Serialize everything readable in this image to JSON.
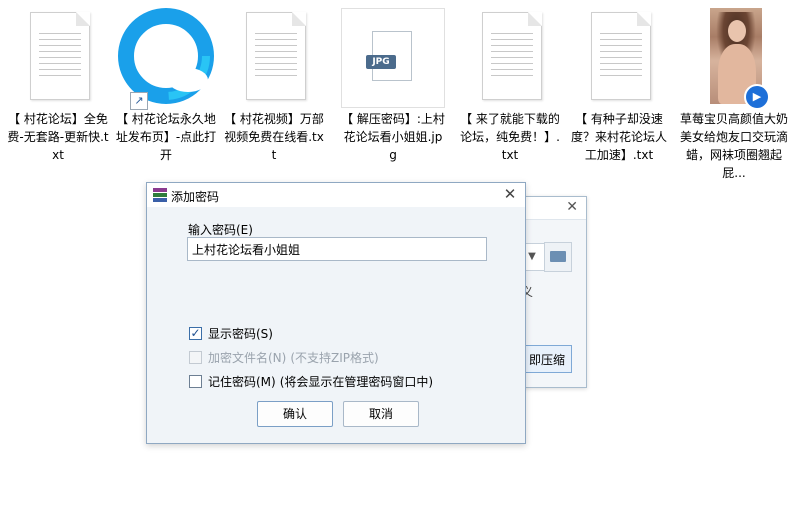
{
  "desktop": {
    "files": [
      {
        "label": "【 村花论坛】全免费-无套路-更新快.txt",
        "icon": "txt-file-icon"
      },
      {
        "label": "【 村花论坛永久地址发布页】-点此打开",
        "icon": "qq-browser-shortcut-icon"
      },
      {
        "label": "【 村花视频】万部视频免费在线看.txt",
        "icon": "txt-file-icon"
      },
      {
        "label": "【 解压密码】:上村花论坛看小姐姐.jpg",
        "icon": "jpg-file-icon",
        "badge": "JPG"
      },
      {
        "label": "【 来了就能下载的论坛，纯免费！】.txt",
        "icon": "txt-file-icon"
      },
      {
        "label": "【 有种子却没速度？来村花论坛人工加速】.txt",
        "icon": "txt-file-icon"
      },
      {
        "label": "草莓宝贝高颜值大奶美女给炮友口交玩滴蜡，网袜项圈翘起屁...",
        "icon": "video-thumbnail-icon"
      }
    ]
  },
  "background_dialog": {
    "text_fragment": "义",
    "extract_button": "即压缩"
  },
  "password_dialog": {
    "title": "添加密码",
    "field_label": "输入密码(E)",
    "password_value": "上村花论坛看小姐姐",
    "options": [
      {
        "label": "显示密码(S)",
        "checked": true,
        "disabled": false,
        "note": ""
      },
      {
        "label": "加密文件名(N)",
        "checked": false,
        "disabled": true,
        "note": "(不支持ZIP格式)"
      },
      {
        "label": "记住密码(M)",
        "checked": false,
        "disabled": false,
        "note": "(将会显示在管理密码窗口中)"
      }
    ],
    "ok_button": "确认",
    "cancel_button": "取消",
    "close_glyph": "✕"
  },
  "colors": {
    "dialog_border": "#8fa8c2",
    "dialog_bg": "#f0f4f8",
    "checkbox_check": "#1f4f8f"
  }
}
